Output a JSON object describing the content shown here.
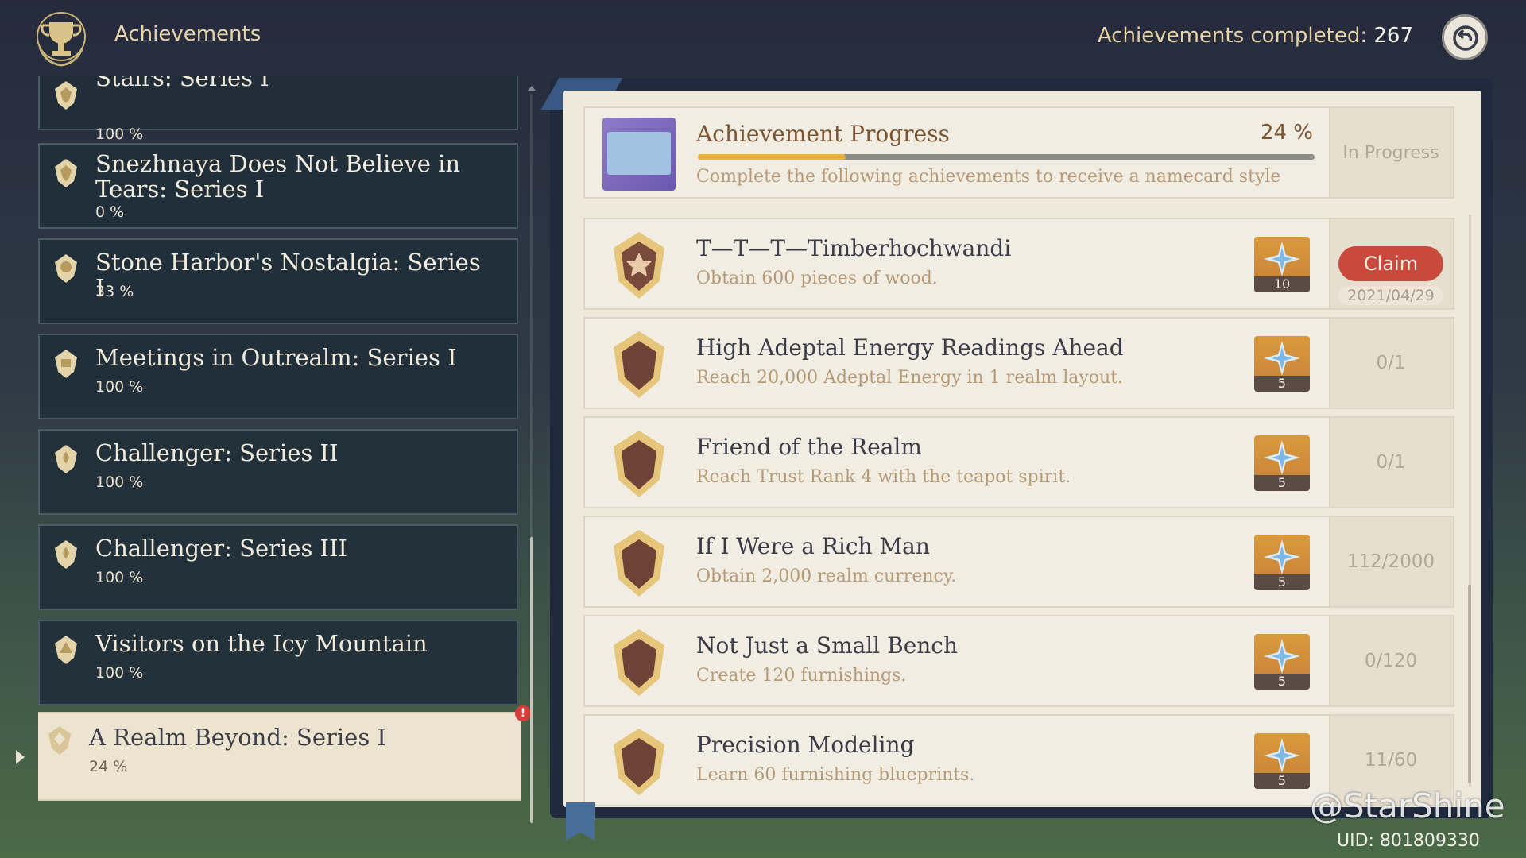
{
  "header": {
    "title": "Achievements",
    "completed_label": "Achievements completed:",
    "completed_count": "267"
  },
  "categories": [
    {
      "name": "Stairs: Series I",
      "pct": "100 %"
    },
    {
      "name": "Snezhnaya Does Not Believe in Tears: Series I",
      "pct": "0 %"
    },
    {
      "name": "Stone Harbor's Nostalgia: Series I",
      "pct": "33 %"
    },
    {
      "name": "Meetings in Outrealm: Series I",
      "pct": "100 %"
    },
    {
      "name": "Challenger: Series II",
      "pct": "100 %"
    },
    {
      "name": "Challenger: Series III",
      "pct": "100 %"
    },
    {
      "name": "Visitors on the Icy Mountain",
      "pct": "100 %"
    },
    {
      "name": "A Realm Beyond: Series I",
      "pct": "24 %",
      "active": true,
      "alert": "!"
    }
  ],
  "summary": {
    "title": "Achievement Progress",
    "percent": "24 %",
    "progress_fraction": 0.24,
    "description": "Complete the following achievements to receive a namecard style",
    "status": "In Progress"
  },
  "achievements": [
    {
      "title": "T—T—T—Timberhochwandi",
      "desc": "Obtain 600 pieces of wood.",
      "reward_qty": "10",
      "claim_label": "Claim",
      "date": "2021/04/29"
    },
    {
      "title": "High Adeptal Energy Readings Ahead",
      "desc": "Reach 20,000 Adeptal Energy in 1 realm layout.",
      "reward_qty": "5",
      "progress": "0/1"
    },
    {
      "title": "Friend of the Realm",
      "desc": "Reach Trust Rank 4 with the teapot spirit.",
      "reward_qty": "5",
      "progress": "0/1"
    },
    {
      "title": "If I Were a Rich Man",
      "desc": "Obtain 2,000 realm currency.",
      "reward_qty": "5",
      "progress": "112/2000"
    },
    {
      "title": "Not Just a Small Bench",
      "desc": "Create 120 furnishings.",
      "reward_qty": "5",
      "progress": "0/120"
    },
    {
      "title": "Precision Modeling",
      "desc": "Learn 60 furnishing blueprints.",
      "reward_qty": "5",
      "progress": "11/60"
    }
  ],
  "watermark": "@StarShine",
  "uid": "UID: 801809330",
  "colors": {
    "accent_progress": "#f0b03c",
    "claim": "#c9493d",
    "title_brown": "#7a5430"
  },
  "icons": {
    "header": "trophy-icon",
    "back": "back-arrow-icon",
    "reward": "primogem-icon",
    "badge": "achievement-badge-icon"
  }
}
